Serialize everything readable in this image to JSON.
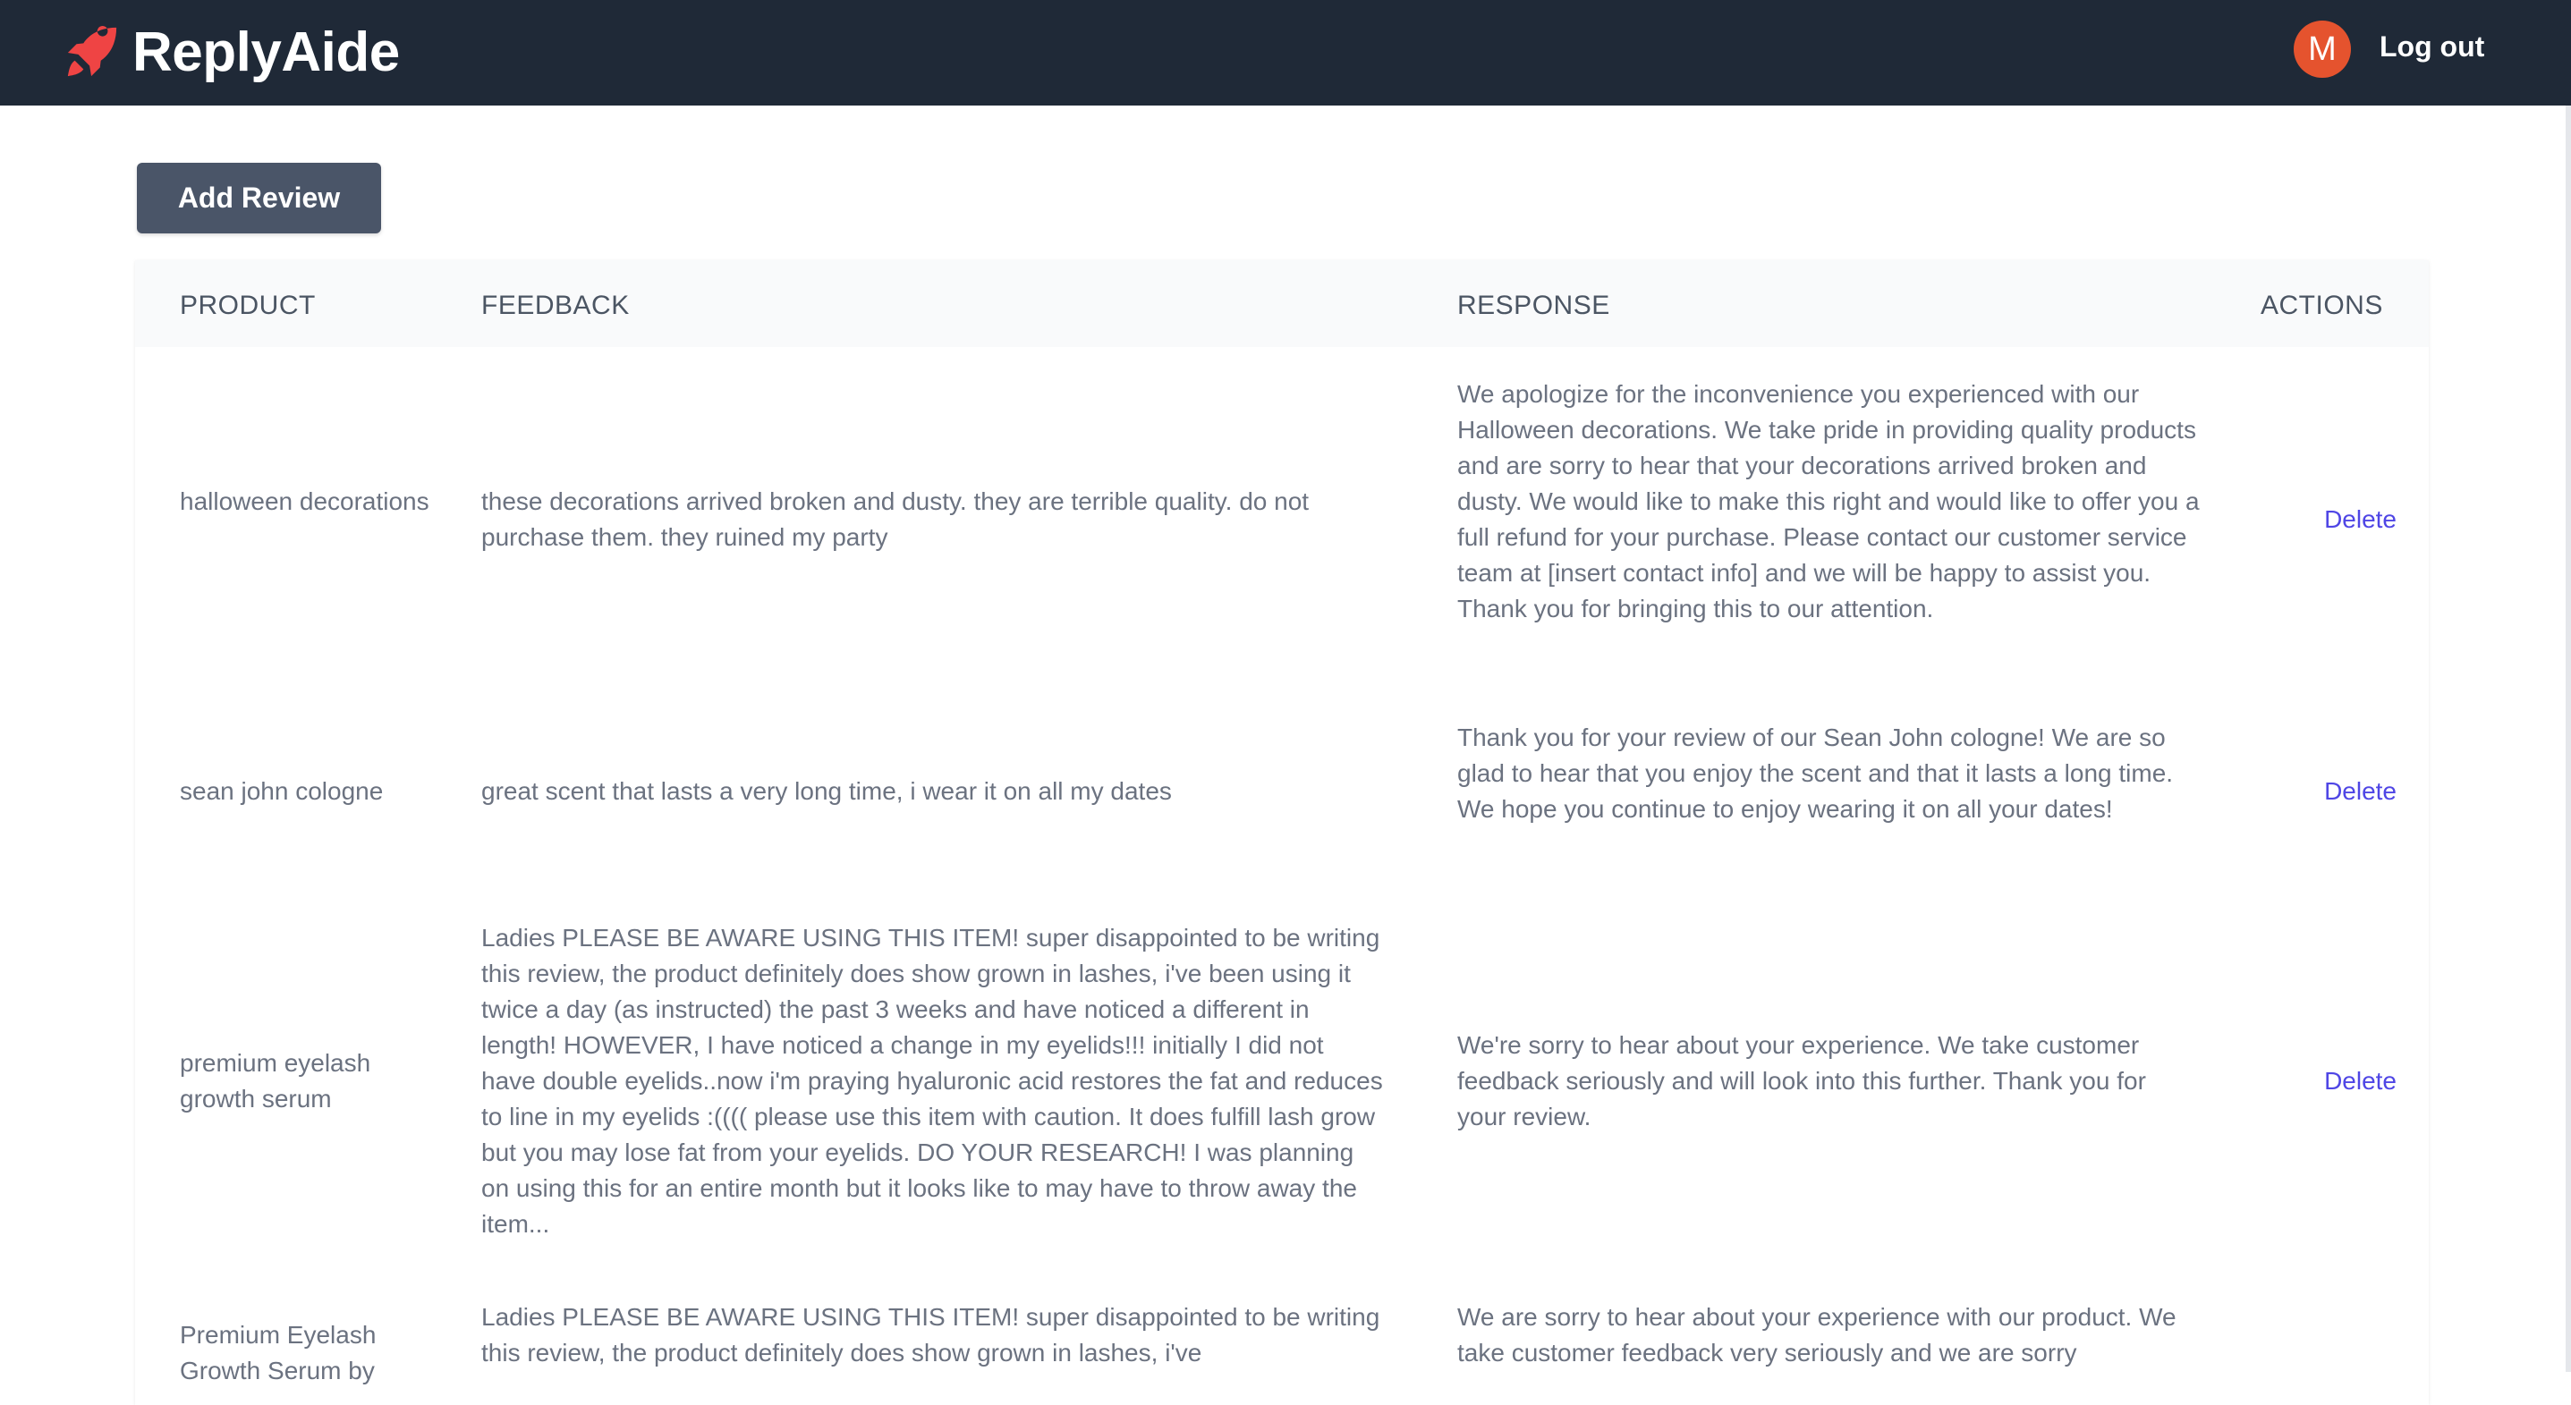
{
  "app": {
    "name": "ReplyAide",
    "logo_icon": "rocket-icon",
    "brand_color": "#ef4444"
  },
  "user": {
    "avatar_initial": "M",
    "avatar_color": "#e5532e",
    "logout_label": "Log out"
  },
  "toolbar": {
    "add_review_label": "Add Review"
  },
  "table": {
    "headers": {
      "product": "PRODUCT",
      "feedback": "FEEDBACK",
      "response": "RESPONSE",
      "actions": "ACTIONS"
    },
    "rows": [
      {
        "product": "halloween decorations",
        "feedback": "these decorations arrived broken and dusty. they are terrible quality. do not purchase them. they ruined my party",
        "response": "We apologize for the inconvenience you experienced with our Halloween decorations. We take pride in providing quality products and are sorry to hear that your decorations arrived broken and dusty. We would like to make this right and would like to offer you a full refund for your purchase. Please contact our customer service team at [insert contact info] and we will be happy to assist you. Thank you for bringing this to our attention.",
        "action": "Delete"
      },
      {
        "product": "sean john cologne",
        "feedback": "great scent that lasts a very long time, i wear it on all my dates",
        "response": "Thank you for your review of our Sean John cologne! We are so glad to hear that you enjoy the scent and that it lasts a long time. We hope you continue to enjoy wearing it on all your dates!",
        "action": "Delete"
      },
      {
        "product": "premium eyelash growth serum",
        "feedback": "Ladies PLEASE BE AWARE USING THIS ITEM! super disappointed to be writing this review, the product definitely does show grown in lashes, i've been using it twice a day (as instructed) the past 3 weeks and have noticed a different in length! HOWEVER, I have noticed a change in my eyelids!!! initially I did not have double eyelids..now i'm praying hyaluronic acid restores the fat and reduces to line in my eyelids :(((( please use this item with caution. It does fulfill lash grow but you may lose fat from your eyelids. DO YOUR RESEARCH! I was planning on using this for an entire month but it looks like to may have to throw away the item...",
        "response": "We're sorry to hear about your experience. We take customer feedback seriously and will look into this further. Thank you for your review.",
        "action": "Delete"
      },
      {
        "product": "Premium Eyelash Growth Serum by",
        "feedback": "Ladies PLEASE BE AWARE USING THIS ITEM! super disappointed to be writing this review, the product definitely does show grown in lashes, i've",
        "response": "We are sorry to hear about your experience with our product. We take customer feedback very seriously and we are sorry",
        "action": ""
      }
    ]
  }
}
